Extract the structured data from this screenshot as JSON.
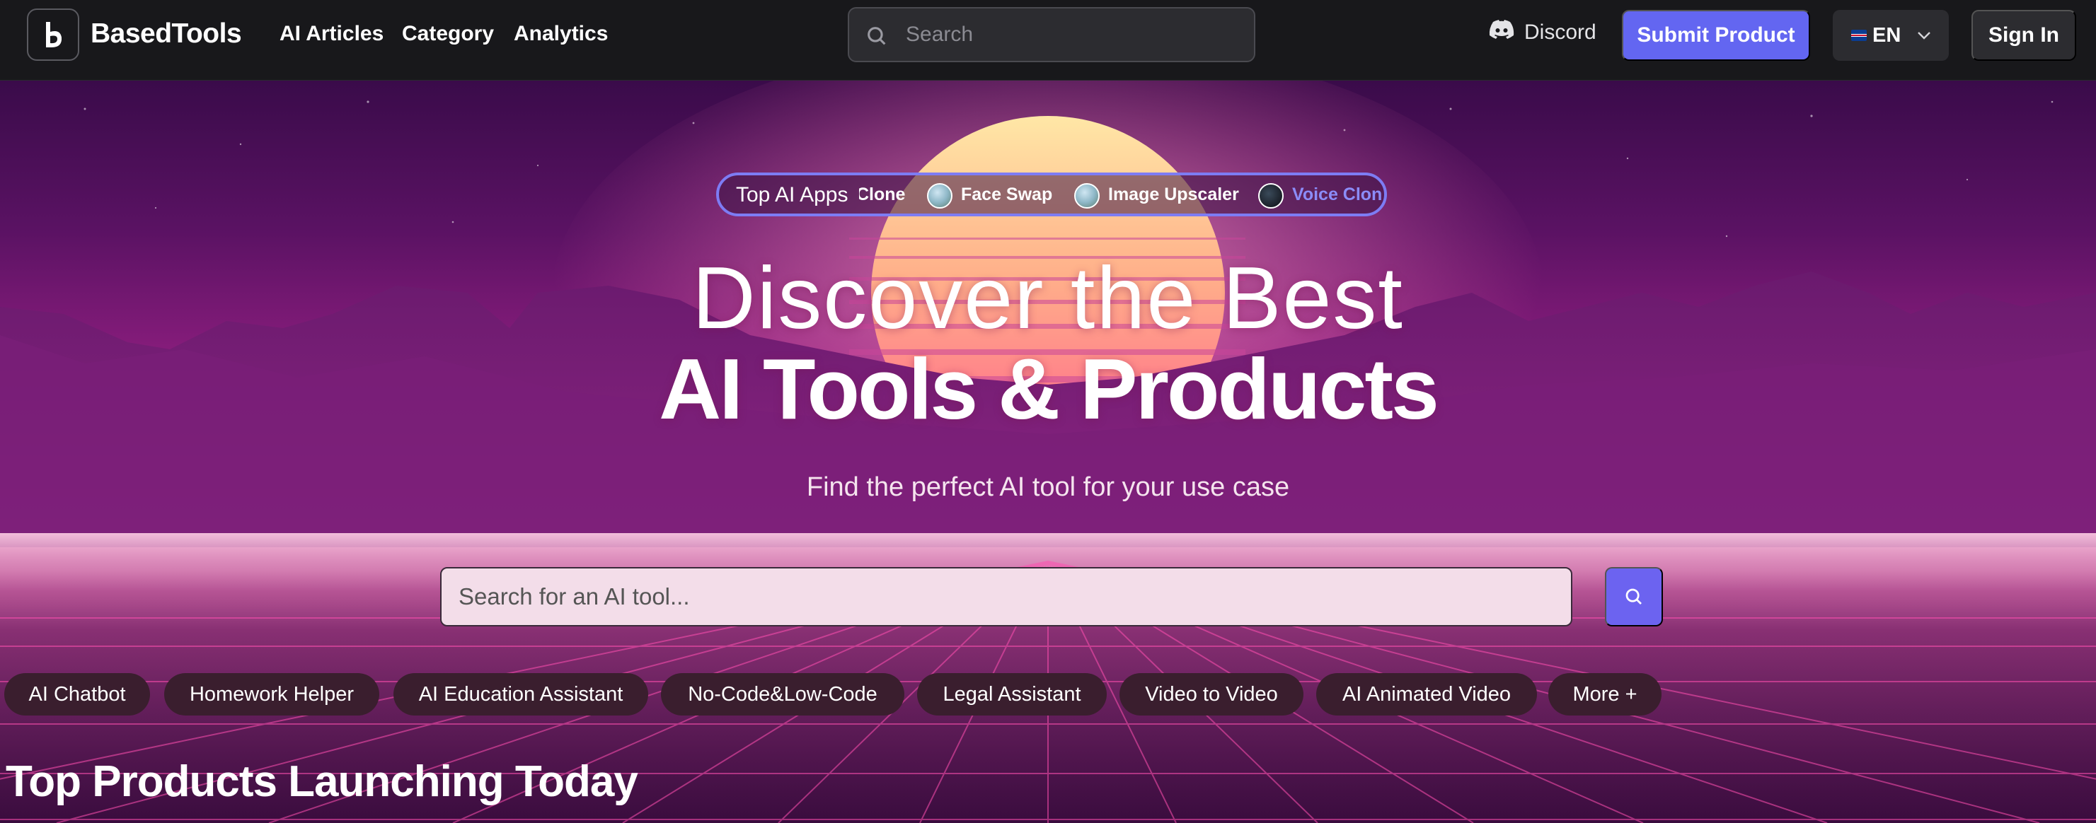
{
  "header": {
    "brand": "BasedTools",
    "nav": [
      "AI Articles",
      "Category",
      "Analytics"
    ],
    "search_placeholder": "Search",
    "discord_label": "Discord",
    "submit_label": "Submit Product",
    "lang_label": "EN",
    "signin_label": "Sign In"
  },
  "ticker": {
    "label": "Top AI Apps",
    "items": [
      "Clone",
      "Face Swap",
      "Image Upscaler",
      "Voice Clon"
    ],
    "highlight_color": "#8b8cf8"
  },
  "hero": {
    "title_line1": "Discover the Best",
    "title_line2": "AI Tools & Products",
    "subtitle": "Find the perfect AI tool for your use case",
    "search_placeholder": "Search for an AI tool..."
  },
  "chips": [
    "AI Chatbot",
    "Homework Helper",
    "AI Education Assistant",
    "No-Code&Low-Code",
    "Legal Assistant",
    "Video to Video",
    "AI Animated Video",
    "More +"
  ],
  "section": {
    "title": "Top Products Launching Today"
  },
  "colors": {
    "accent": "#6366f1",
    "header_bg": "#18181b"
  }
}
